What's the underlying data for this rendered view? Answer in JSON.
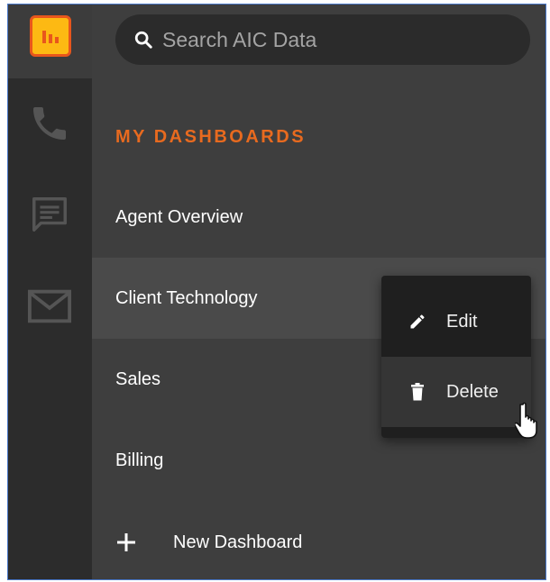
{
  "search": {
    "placeholder": "Search AIC Data"
  },
  "rail": {
    "icons": [
      "bar-chart-icon",
      "phone-icon",
      "chat-icon",
      "mail-icon"
    ],
    "colors": {
      "logo": "#fdb913",
      "logo_border": "#e8561c"
    }
  },
  "dashboards": {
    "title": "MY DASHBOARDS",
    "items": [
      {
        "label": "Agent Overview"
      },
      {
        "label": "Client Technology"
      },
      {
        "label": "Sales"
      },
      {
        "label": "Billing"
      }
    ],
    "new_label": "New Dashboard"
  },
  "context_menu": {
    "edit_label": "Edit",
    "delete_label": "Delete"
  },
  "colors": {
    "accent": "#e86a1f",
    "panel": "#3e3e3e",
    "rail": "#2c2c2c",
    "menu": "#1f1f1f"
  }
}
